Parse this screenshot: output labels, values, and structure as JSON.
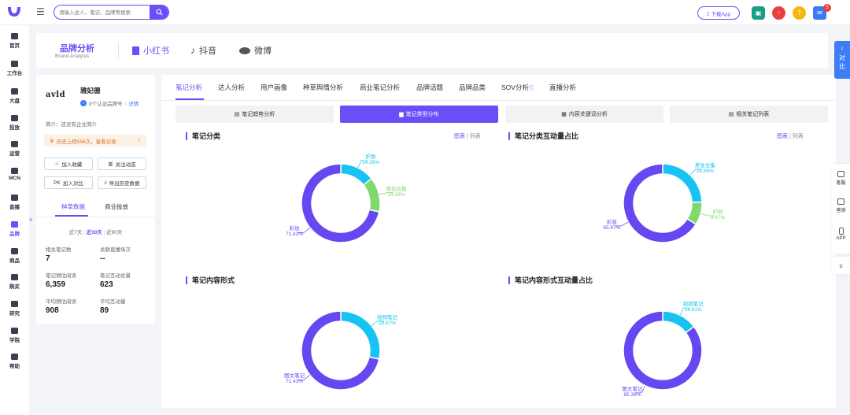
{
  "colors": {
    "accent": "#6b4ef7",
    "primary_slice": "#6647f1",
    "cyan_slice": "#17c3f2",
    "green_slice": "#7fd96e",
    "history_bg": "#fdf0e4",
    "history_text": "#d0792a",
    "blue_link": "#3a7af5"
  },
  "topbar": {
    "search_placeholder": "请输入达人、笔记、品牌等搜索",
    "download_app": "下载App",
    "notification_count": "5",
    "icons": [
      "menu-icon",
      "search-icon",
      "gift-icon",
      "grid-icon",
      "help-icon",
      "message-icon"
    ]
  },
  "sidebar": {
    "items": [
      {
        "label": "首页",
        "icon": "home-icon"
      },
      {
        "label": "工作台",
        "icon": "desk-icon"
      },
      {
        "label": "大盘",
        "icon": "market-icon"
      },
      {
        "label": "投放",
        "icon": "ad-icon"
      },
      {
        "label": "运营",
        "icon": "ops-icon"
      },
      {
        "label": "MCN",
        "icon": "mcn-icon"
      },
      {
        "label": "直播",
        "icon": "live-icon"
      },
      {
        "label": "品牌",
        "icon": "brand-icon"
      },
      {
        "label": "商品",
        "icon": "goods-icon"
      },
      {
        "label": "购买",
        "icon": "cart-icon"
      },
      {
        "label": "研究",
        "icon": "research-icon"
      },
      {
        "label": "学院",
        "icon": "academy-icon"
      },
      {
        "label": "帮助",
        "icon": "help-icon"
      }
    ],
    "active": "品牌"
  },
  "header": {
    "title": "品牌分析",
    "subtitle": "Brand Analysis",
    "platforms": [
      {
        "label": "小红书",
        "icon": "xiaohongshu-icon"
      },
      {
        "label": "抖音",
        "icon": "douyin-icon"
      },
      {
        "label": "微博",
        "icon": "weibo-icon"
      }
    ]
  },
  "brand": {
    "logo_text": "avld",
    "name": "雅妃德",
    "cert": "0个认证品牌号",
    "cert_link": "详情",
    "intro": "简介：还没有企业简介",
    "history": "历史上榜556次，查看记录",
    "buttons": {
      "favorite": "加入收藏",
      "follow": "关注动态",
      "compare": "加入对比",
      "export": "导出历史数据"
    },
    "tabs": [
      "种草数据",
      "商业投放"
    ],
    "range": [
      "近7天",
      "近30天",
      "近90天"
    ],
    "stats": [
      {
        "label": "相关笔记数",
        "value": "7"
      },
      {
        "label": "关联直播场次",
        "value": "--"
      },
      {
        "label": "笔记预估阅读",
        "value": "6,359"
      },
      {
        "label": "笔记互动总量",
        "value": "623"
      },
      {
        "label": "平均预估阅读",
        "value": "908"
      },
      {
        "label": "平均互动量",
        "value": "89"
      }
    ]
  },
  "main": {
    "tabs": [
      "笔记分析",
      "达人分析",
      "用户画像",
      "种草舆情分析",
      "商业笔记分析",
      "品牌话题",
      "品牌品类",
      "SOV分析",
      "直播分析"
    ],
    "subtabs": [
      "笔记趋势分析",
      "笔记类型分布",
      "内容关键词分析",
      "相关笔记列表"
    ],
    "view_chart": "图表",
    "view_list": "列表"
  },
  "chart_data": [
    {
      "type": "pie",
      "title": "笔记分类",
      "slices": [
        {
          "name": "彩妆",
          "pct": "71.43%",
          "value": 71.43,
          "color": "#6647f1"
        },
        {
          "name": "护肤",
          "pct": "14.29%",
          "value": 14.29,
          "color": "#17c3f2"
        },
        {
          "name": "美妆合集",
          "pct": "14.28%",
          "value": 14.28,
          "color": "#7fd96e"
        }
      ]
    },
    {
      "type": "pie",
      "title": "笔记分类互动量占比",
      "slices": [
        {
          "name": "彩妆",
          "pct": "65.97%",
          "value": 65.97,
          "color": "#6647f1"
        },
        {
          "name": "美妆合集",
          "pct": "24.56%",
          "value": 24.56,
          "color": "#17c3f2"
        },
        {
          "name": "护肤",
          "pct": "9.47%",
          "value": 9.47,
          "color": "#7fd96e"
        }
      ]
    },
    {
      "type": "pie",
      "title": "笔记内容形式",
      "slices": [
        {
          "name": "图文笔记",
          "pct": "71.43%",
          "value": 71.43,
          "color": "#6647f1"
        },
        {
          "name": "视频笔记",
          "pct": "28.57%",
          "value": 28.57,
          "color": "#17c3f2"
        }
      ]
    },
    {
      "type": "pie",
      "title": "笔记内容形式互动量占比",
      "slices": [
        {
          "name": "图文笔记",
          "pct": "85.39%",
          "value": 85.39,
          "color": "#6647f1"
        },
        {
          "name": "视频笔记",
          "pct": "14.61%",
          "value": 14.61,
          "color": "#17c3f2"
        }
      ]
    }
  ],
  "right": {
    "compare": "对比",
    "tools": [
      "客服",
      "营销",
      "APP"
    ]
  }
}
